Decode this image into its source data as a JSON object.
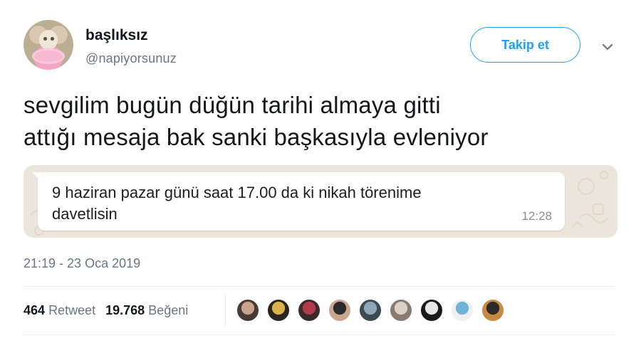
{
  "user": {
    "display_name": "başlıksız",
    "handle": "@napiyorsunuz"
  },
  "actions": {
    "follow_label": "Takip et"
  },
  "tweet": {
    "text_lines": [
      "sevgilim bugün düğün tarihi almaya gitti",
      "attığı mesaja bak sanki başkasıyla evleniyor"
    ],
    "timestamp": "21:19 - 23 Oca 2019"
  },
  "media": {
    "message_lines": [
      "9 haziran pazar günü saat 17.00 da ki nikah törenime",
      "davetlisin"
    ],
    "message_time": "12:28"
  },
  "stats": {
    "retweet_count": "464",
    "retweet_label": "Retweet",
    "like_count": "19.768",
    "like_label": "Beğeni"
  },
  "likers": [
    {
      "name": "liker-avatar-1",
      "colors": [
        "#c9a48a",
        "#4a3a35"
      ]
    },
    {
      "name": "liker-avatar-2",
      "colors": [
        "#d8b24a",
        "#2b2320"
      ]
    },
    {
      "name": "liker-avatar-3",
      "colors": [
        "#b23b4a",
        "#3a2a2a"
      ]
    },
    {
      "name": "liker-avatar-4",
      "colors": [
        "#2a2a2a",
        "#caa68e"
      ]
    },
    {
      "name": "liker-avatar-5",
      "colors": [
        "#8fa7b8",
        "#3d4a52"
      ]
    },
    {
      "name": "liker-avatar-6",
      "colors": [
        "#d9d2c8",
        "#8a7a70"
      ]
    },
    {
      "name": "liker-avatar-7",
      "colors": [
        "#e7e7e7",
        "#1a1a1a"
      ]
    },
    {
      "name": "liker-avatar-8",
      "colors": [
        "#6fb4d6",
        "#f0f0f0"
      ]
    },
    {
      "name": "liker-avatar-9",
      "colors": [
        "#2b2b2b",
        "#c88a40"
      ]
    }
  ],
  "colors": {
    "accent": "#1da1f2",
    "secondary_text": "#657786",
    "chat_background": "#ece5dc"
  }
}
